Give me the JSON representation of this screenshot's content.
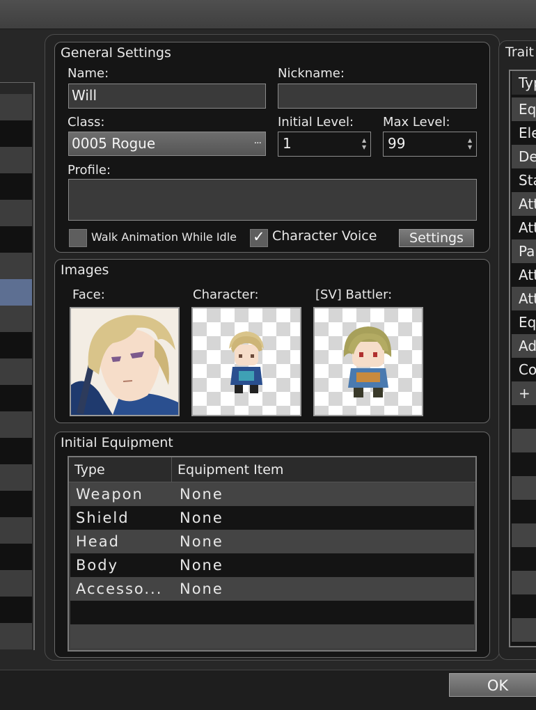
{
  "general": {
    "title": "General Settings",
    "name_label": "Name:",
    "name_value": "Will",
    "nickname_label": "Nickname:",
    "nickname_value": "",
    "class_label": "Class:",
    "class_value": "0005 Rogue",
    "class_more": "···",
    "initial_level_label": "Initial Level:",
    "initial_level_value": "1",
    "max_level_label": "Max Level:",
    "max_level_value": "99",
    "profile_label": "Profile:",
    "profile_value": "",
    "walk_anim_label": "Walk Animation While Idle",
    "walk_anim_checked": false,
    "char_voice_label": "Character Voice",
    "char_voice_checked": true,
    "settings_button": "Settings"
  },
  "images": {
    "title": "Images",
    "face_label": "Face:",
    "character_label": "Character:",
    "battler_label": "[SV] Battler:"
  },
  "equipment": {
    "title": "Initial Equipment",
    "columns": [
      "Type",
      "Equipment Item"
    ],
    "rows": [
      {
        "type": "Weapon",
        "item": "None"
      },
      {
        "type": "Shield",
        "item": "None"
      },
      {
        "type": "Head",
        "item": "None"
      },
      {
        "type": "Body",
        "item": "None"
      },
      {
        "type": "Accesso...",
        "item": "None"
      }
    ]
  },
  "traits": {
    "title": "Trait",
    "header": "Typ",
    "rows": [
      "Eq",
      "Ele",
      "De",
      "Sta",
      "Att",
      "Att",
      "Pa",
      "Att",
      "Att",
      "Eq",
      "Ad",
      "Co",
      "+"
    ]
  },
  "footer": {
    "ok_button": "OK"
  },
  "colors": {
    "selected_row": "#5d6f92",
    "panel_bg": "#151515"
  }
}
